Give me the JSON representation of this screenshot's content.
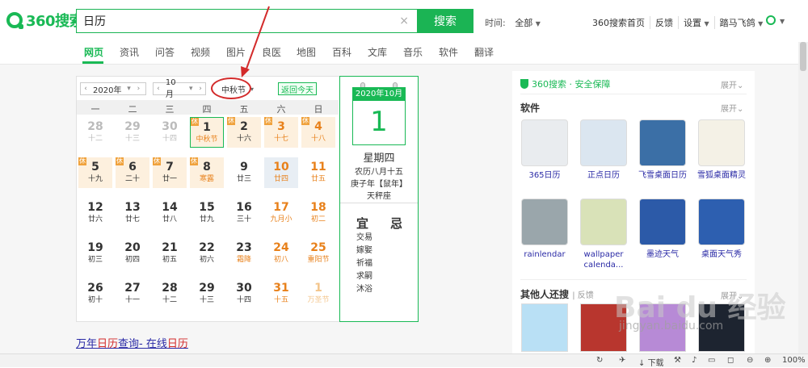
{
  "header": {
    "logo_text": "360搜索",
    "search_value": "日历",
    "clear_icon": "×",
    "search_button": "搜索",
    "time_label": "时间:",
    "time_value": "全部",
    "links": [
      "360搜索首页",
      "反馈",
      "设置",
      "踏马飞鸽"
    ]
  },
  "nav": {
    "tabs": [
      "网页",
      "资讯",
      "问答",
      "视频",
      "图片",
      "良医",
      "地图",
      "百科",
      "文库",
      "音乐",
      "软件",
      "翻译"
    ],
    "active": "网页"
  },
  "calendar": {
    "year_select": "2020年",
    "month_select": "10月",
    "holiday_select": "中秋节",
    "today_button": "返回今天",
    "weekdays": [
      "一",
      "二",
      "三",
      "四",
      "五",
      "六",
      "日"
    ],
    "weeks": [
      [
        [
          "28",
          "十二",
          "prev"
        ],
        [
          "29",
          "十三",
          "prev"
        ],
        [
          "30",
          "十四",
          "prev"
        ],
        [
          "1",
          "中秋节",
          "rest sel-day fest"
        ],
        [
          "2",
          "十六",
          "rest"
        ],
        [
          "3",
          "十七",
          "rest red"
        ],
        [
          "4",
          "十八",
          "rest red"
        ]
      ],
      [
        [
          "5",
          "十九",
          "rest"
        ],
        [
          "6",
          "二十",
          "rest"
        ],
        [
          "7",
          "廿一",
          "rest"
        ],
        [
          "8",
          "寒露",
          "rest fest"
        ],
        [
          "9",
          "廿三",
          ""
        ],
        [
          "10",
          "廿四",
          "today red"
        ],
        [
          "11",
          "廿五",
          "red"
        ]
      ],
      [
        [
          "12",
          "廿六",
          ""
        ],
        [
          "13",
          "廿七",
          ""
        ],
        [
          "14",
          "廿八",
          ""
        ],
        [
          "15",
          "廿九",
          ""
        ],
        [
          "16",
          "三十",
          ""
        ],
        [
          "17",
          "九月小",
          "red"
        ],
        [
          "18",
          "初二",
          "red"
        ]
      ],
      [
        [
          "19",
          "初三",
          ""
        ],
        [
          "20",
          "初四",
          ""
        ],
        [
          "21",
          "初五",
          ""
        ],
        [
          "22",
          "初六",
          ""
        ],
        [
          "23",
          "霜降",
          "fest"
        ],
        [
          "24",
          "初八",
          "red"
        ],
        [
          "25",
          "重阳节",
          "red fest"
        ]
      ],
      [
        [
          "26",
          "初十",
          ""
        ],
        [
          "27",
          "十一",
          ""
        ],
        [
          "28",
          "十二",
          ""
        ],
        [
          "29",
          "十三",
          ""
        ],
        [
          "30",
          "十四",
          ""
        ],
        [
          "31",
          "十五",
          "red"
        ],
        [
          "1",
          "万圣节",
          "next"
        ]
      ]
    ],
    "side": {
      "year_month": "2020年10月",
      "day": "1",
      "weekday": "星期四",
      "lunar": "农历八月十五",
      "ganzhi": "庚子年【鼠年】",
      "zodiac": "天秤座",
      "yi": "宜",
      "ji": "忌",
      "yi_items": [
        "交易",
        "嫁娶",
        "祈福",
        "求嗣",
        "沐浴"
      ]
    }
  },
  "result": {
    "title_prefix": "万年",
    "title_hl1": "日历",
    "title_mid": "查询- 在线",
    "title_hl2": "日历"
  },
  "panel": {
    "safe_text": "360搜索 · 安全保障",
    "expand": "展开",
    "software_title": "软件",
    "apps": [
      {
        "name": "365日历",
        "color": "#e9ecef"
      },
      {
        "name": "正点日历",
        "color": "#dbe6f0"
      },
      {
        "name": "飞雪桌面日历",
        "color": "#3b6fa6"
      },
      {
        "name": "雪狐桌面精灵",
        "color": "#f4f1e6"
      },
      {
        "name": "rainlendar",
        "color": "#9aa6ab"
      },
      {
        "name": "wallpaper calenda...",
        "color": "#d9e2b8"
      },
      {
        "name": "墨迹天气",
        "color": "#2c5aa8"
      },
      {
        "name": "桌面天气秀",
        "color": "#2d5fb0"
      }
    ],
    "others_title": "其他人还搜",
    "others_feedback": "反馈"
  },
  "statusbar": {
    "download": "下载",
    "zoom": "100%"
  },
  "watermark": {
    "main": "Bai du 经验",
    "sub": "jingyan.baidu.com"
  }
}
